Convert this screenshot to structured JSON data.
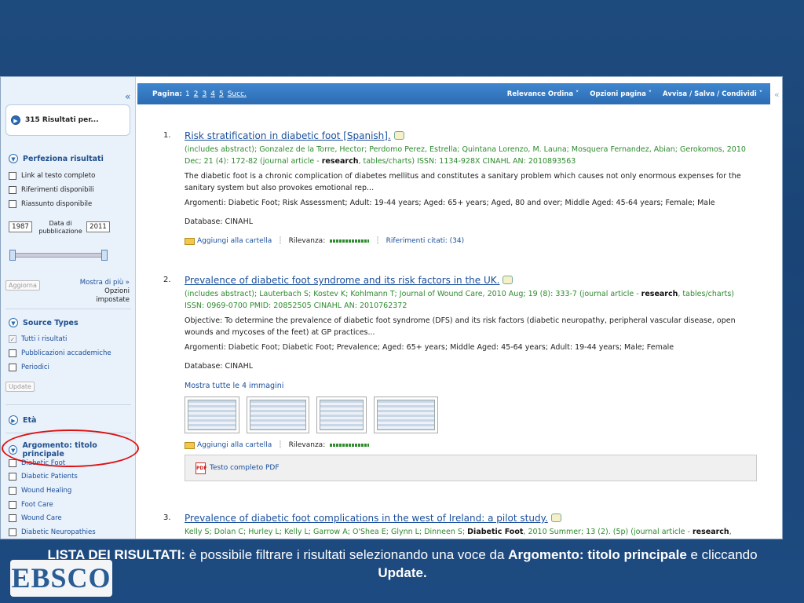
{
  "sidebar": {
    "collapse": "«",
    "results_count": "315 Risultati per...",
    "refine": {
      "heading": "Perfeziona risultati",
      "options": [
        "Link al testo completo",
        "Riferimenti disponibili",
        "Riassunto disponibile"
      ],
      "year_from": "1987",
      "year_to": "2011",
      "date_label": "Data di pubblicazione",
      "update": "Aggiorna",
      "show_more": "Mostra di più »",
      "set_options": "Opzioni impostate"
    },
    "source_types": {
      "heading": "Source Types",
      "options": [
        "Tutti i risultati",
        "Pubblicazioni accademiche",
        "Periodici"
      ],
      "update": "Update"
    },
    "age": {
      "heading": "Età"
    },
    "subject": {
      "heading": "Argomento: titolo principale",
      "options": [
        "Diabetic Foot",
        "Diabetic Patients",
        "Wound Healing",
        "Foot Care",
        "Wound Care",
        "Diabetic Neuropathies"
      ]
    }
  },
  "topbar": {
    "page_label": "Pagina:",
    "pages": [
      "1",
      "2",
      "3",
      "4",
      "5"
    ],
    "next": "Succ.",
    "sort": "Relevance Ordina ˅",
    "page_options": "Opzioni pagina ˅",
    "share": "Avvisa / Salva / Condividi ˅",
    "collapse": "«"
  },
  "results": [
    {
      "num": "1.",
      "title": "Risk stratification in diabetic foot [Spanish].",
      "citation_a": "(includes abstract); Gonzalez de la Torre, Hector; Perdomo Perez, Estrella; Quintana Lorenzo, M. Launa; Mosquera Fernandez, Abian; Gerokomos, 2010 Dec; 21 (4): 172-82 (journal article - ",
      "citation_bold": "research",
      "citation_b": ", tables/charts) ISSN: 1134-928X CINAHL AN: 2010893563",
      "abstract": "The diabetic foot is a chronic complication of diabetes mellitus and constitutes a sanitary problem which causes not only enormous expenses for the sanitary system but also provokes emotional rep...",
      "subjects": "Argomenti: Diabetic Foot; Risk Assessment; Adult: 19-44 years; Aged: 65+ years; Aged, 80 and over; Middle Aged: 45-64 years; Female; Male",
      "database": "Database: CINAHL",
      "add": "Aggiungi alla cartella",
      "relevance": "Rilevanza:",
      "cited": "Riferimenti citati: (34)"
    },
    {
      "num": "2.",
      "title": "Prevalence of diabetic foot syndrome and its risk factors in the UK.",
      "citation_a": "(includes abstract); Lauterbach S; Kostev K; Kohlmann T; Journal of Wound Care, 2010 Aug; 19 (8): 333-7 (journal article - ",
      "citation_bold": "research",
      "citation_b": ", tables/charts) ISSN: 0969-0700 PMID: 20852505 CINAHL AN: 2010762372",
      "abstract": "Objective: To determine the prevalence of diabetic foot syndrome (DFS) and its risk factors (diabetic neuropathy, peripheral vascular disease, open wounds and mycoses of the feet) at GP practices...",
      "subjects": "Argomenti: Diabetic Foot; Diabetic Foot; Prevalence; Aged: 65+ years; Middle Aged: 45-64 years; Adult: 19-44 years; Male; Female",
      "database": "Database: CINAHL",
      "images_link": "Mostra tutte le 4 immagini",
      "add": "Aggiungi alla cartella",
      "relevance": "Rilevanza:",
      "pdf": "Testo completo PDF"
    },
    {
      "num": "3.",
      "title": "Prevalence of diabetic foot complications in the west of Ireland: a pilot study.",
      "citation_a": "Kelly S; Dolan C; Hurley L; Kelly L; Garrow A; O'Shea E; Glynn L; Dinneen S; ",
      "citation_bold2": "Diabetic Foot",
      "citation_b": ", 2010 Summer; 13 (2). (5p) (journal article - ",
      "citation_bold": "research",
      "citation_c": ","
    }
  ],
  "caption": {
    "lead": "LISTA DEI RISULTATI:",
    "text1": " è possibile filtrare i risultati selezionando una voce da ",
    "bold1": "Argomento: titolo principale",
    "text2": " e cliccando ",
    "bold2": "Update."
  },
  "logo": "EBSCO",
  "colors": {
    "accent": "#2b6cb3",
    "highlight": "#dd1111",
    "citation_green": "#2d8a2d"
  }
}
